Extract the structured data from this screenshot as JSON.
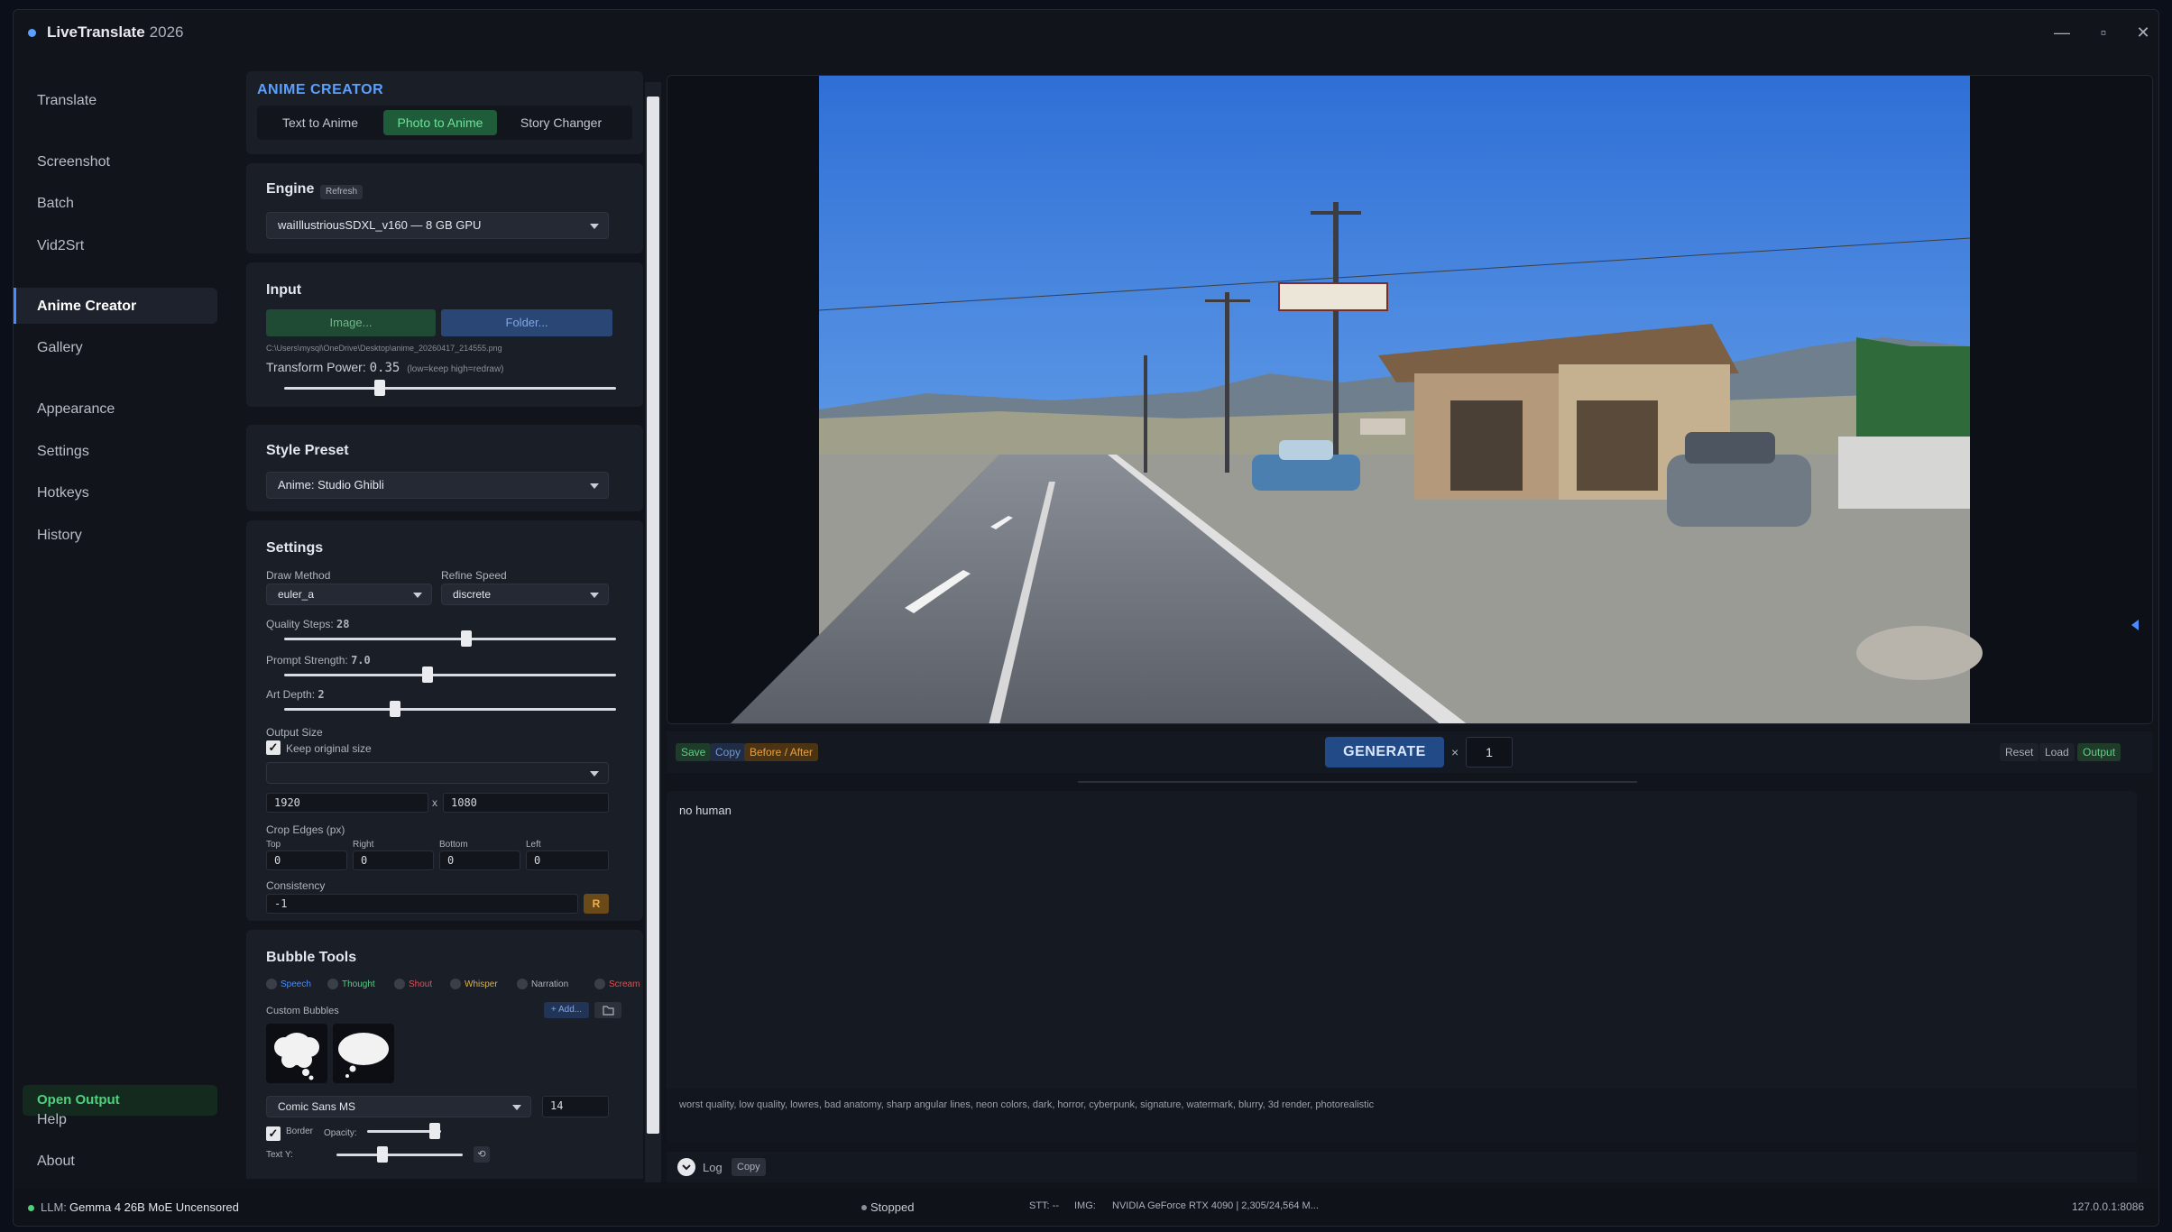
{
  "window": {
    "title": "LiveTranslate",
    "year": "2026",
    "controls": {
      "minimize": "—",
      "maximize": "▫",
      "close": "✕"
    }
  },
  "nav": {
    "items": [
      "Translate",
      "Screenshot",
      "Batch",
      "Vid2Srt",
      "Anime Creator",
      "Gallery",
      "Appearance",
      "Settings",
      "Hotkeys",
      "History"
    ],
    "active": "Anime Creator",
    "open_output": "Open Output",
    "help": "Help",
    "about": "About"
  },
  "panel": {
    "header": "ANIME CREATOR",
    "tabs": [
      "Text to Anime",
      "Photo to Anime",
      "Story Changer"
    ],
    "active_tab": "Photo to Anime",
    "engine": {
      "title": "Engine",
      "refresh": "Refresh",
      "model": "waiIllustriousSDXL_v160 — 8 GB GPU"
    },
    "input": {
      "title": "Input",
      "image_btn": "Image...",
      "folder_btn": "Folder...",
      "path": "C:\\Users\\mysql\\OneDrive\\Desktop\\anime_20260417_214555.png",
      "transform_label": "Transform Power:",
      "transform_value": "0.35",
      "transform_hint": "(low=keep  high=redraw)",
      "transform_level": 0.28
    },
    "style": {
      "title": "Style Preset",
      "value": "Anime: Studio Ghibli"
    },
    "settings": {
      "title": "Settings",
      "draw_method_label": "Draw Method",
      "draw_method": "euler_a",
      "refine_speed_label": "Refine Speed",
      "refine_speed": "discrete",
      "quality_label": "Quality Steps:",
      "quality_value": "28",
      "quality_level": 0.55,
      "prompt_label": "Prompt Strength:",
      "prompt_value": "7.0",
      "prompt_level": 0.43,
      "art_label": "Art Depth:",
      "art_value": "2",
      "art_level": 0.33,
      "output_size_label": "Output Size",
      "keep_original": "Keep original size",
      "width": "1920",
      "x": "x",
      "height": "1080",
      "crop_label": "Crop Edges (px)",
      "crop": [
        {
          "label": "Top",
          "value": "0"
        },
        {
          "label": "Right",
          "value": "0"
        },
        {
          "label": "Bottom",
          "value": "0"
        },
        {
          "label": "Left",
          "value": "0"
        }
      ],
      "consistency_label": "Consistency",
      "consistency_value": "-1",
      "consistency_btn": "R"
    },
    "bubble": {
      "title": "Bubble Tools",
      "types": [
        {
          "label": "Speech",
          "color": "#4a8cff"
        },
        {
          "label": "Thought",
          "color": "#4fd07d"
        },
        {
          "label": "Shout",
          "color": "#e0505a"
        },
        {
          "label": "Whisper",
          "color": "#e0b040"
        },
        {
          "label": "Narration",
          "color": "#aeb3bd"
        },
        {
          "label": "Scream",
          "color": "#e05050"
        }
      ],
      "custom_label": "Custom Bubbles",
      "add_btn": "+ Add...",
      "font": "Comic Sans MS",
      "font_size": "14",
      "border_label": "Border",
      "opacity_label": "Opacity:",
      "opacity_level": 0.98,
      "text_y_label": "Text Y:",
      "text_y_level": 0.35
    }
  },
  "preview": {
    "save": "Save",
    "copy": "Copy",
    "before_after": "Before / After",
    "generate": "GENERATE",
    "times": "×",
    "count": "1",
    "reset": "Reset",
    "load": "Load",
    "output": "Output"
  },
  "prompt": {
    "positive": "no human",
    "negative": "worst quality, low quality, lowres, bad anatomy, sharp angular lines, neon colors, dark, horror, cyberpunk, signature, watermark, blurry, 3d render, photorealistic"
  },
  "log": {
    "label": "Log",
    "copy": "Copy"
  },
  "status": {
    "llm_prefix": "LLM:",
    "llm": "Gemma 4 26B MoE Uncensored",
    "state": "Stopped",
    "stt": "STT: --",
    "img": "IMG:",
    "gpu": "NVIDIA GeForce RTX 4090 | 2,305/24,564 M...",
    "addr": "127.0.0.1:8086"
  },
  "colors": {
    "accent": "#4a8cff",
    "green": "#4fd07d",
    "orange": "#e8a040"
  }
}
